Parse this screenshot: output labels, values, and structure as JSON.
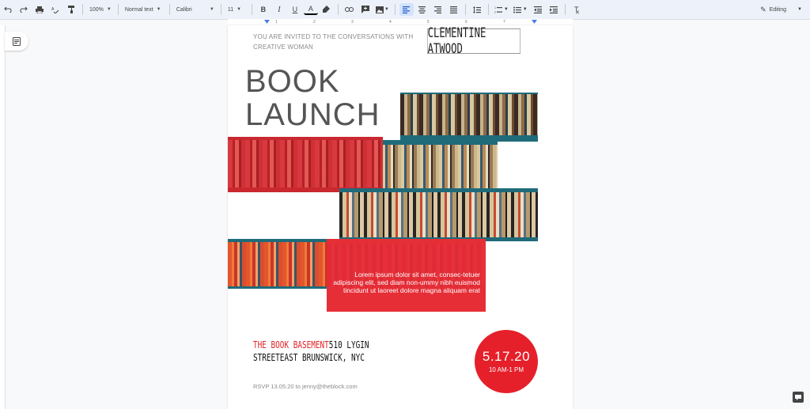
{
  "toolbar": {
    "zoom": "100%",
    "style": "Normal text",
    "font": "Calibri",
    "font_size": "11",
    "mode": "Editing"
  },
  "ruler": {
    "ticks": [
      "1",
      "2",
      "3",
      "4",
      "5",
      "6",
      "7"
    ]
  },
  "document": {
    "invite_line1": "YOU ARE INVITED TO THE CONVERSATIONS WITH",
    "invite_line2": "CREATIVE WOMAN",
    "guest_name": "CLEMENTINE ATWOOD",
    "title_line1": "BOOK",
    "title_line2": "LAUNCH",
    "lorem": "Lorem ipsum dolor sit amet, consec-tetuer adipiscing elit, sed diam non-ummy nibh euismod tincidunt ut laoreet dolore magna aliquam erat",
    "venue_name": "THE BOOK BASEMENT",
    "venue_addr1": "510 LYGIN",
    "venue_addr2": "STREETEAST BRUNSWICK, NYC",
    "rsvp": "RSVP 13.05.20 to jenny@theblock.com",
    "date": "5.17.20",
    "time": "10 AM-1 PM"
  },
  "colors": {
    "accent_red": "#e5202a",
    "teal_shelf": "#1f6b7a"
  }
}
